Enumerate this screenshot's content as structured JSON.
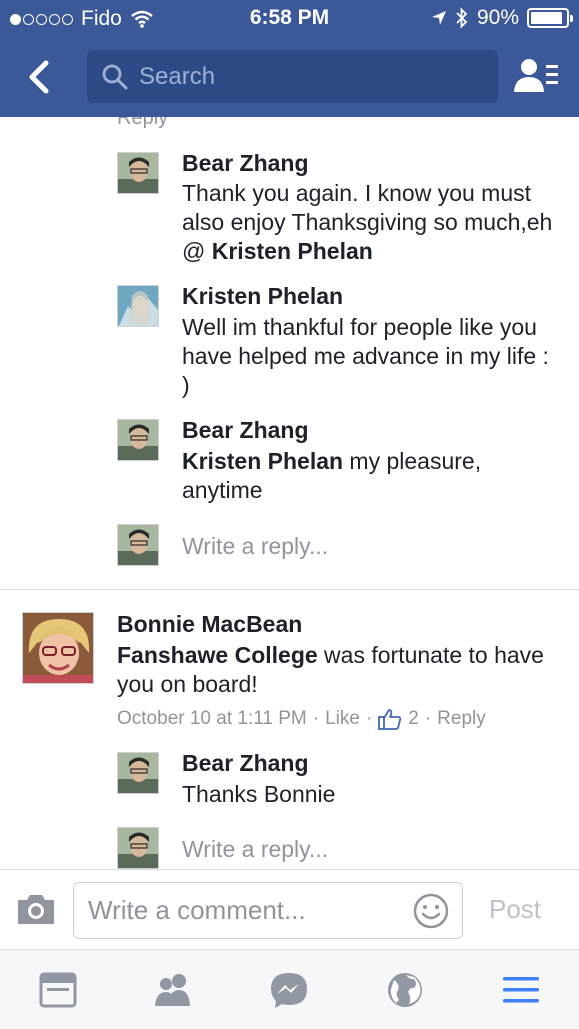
{
  "status": {
    "carrier": "Fido",
    "time": "6:58 PM",
    "battery": "90%"
  },
  "nav": {
    "search_placeholder": "Search"
  },
  "thread": {
    "partial_reply": "Reply",
    "replies": [
      {
        "name": "Bear Zhang",
        "text": "Thank you again. I know you must also enjoy Thanksgiving so much,eh @ ",
        "mention": "Kristen Phelan"
      },
      {
        "name": "Kristen Phelan",
        "text": "Well im thankful for people like you have helped me advance in my life : )"
      },
      {
        "name": "Bear Zhang",
        "mention": "Kristen Phelan",
        "text": " my pleasure, anytime"
      }
    ],
    "write_reply_placeholder": "Write a reply..."
  },
  "comment": {
    "name": "Bonnie MacBean",
    "mention": "Fanshawe College",
    "text": " was fortunate to have you on board!",
    "timestamp": "October 10 at 1:11 PM",
    "sep1": "·",
    "like_label": "Like",
    "sep2": "·",
    "like_count": "2",
    "sep3": "·",
    "reply_label": "Reply",
    "reply": {
      "name": "Bear Zhang",
      "text": "Thanks Bonnie"
    },
    "write_reply_placeholder": "Write a reply..."
  },
  "compose": {
    "placeholder": "Write a comment...",
    "post_label": "Post"
  },
  "tabs": [
    {
      "icon": "news-feed-icon"
    },
    {
      "icon": "friends-icon"
    },
    {
      "icon": "messenger-icon"
    },
    {
      "icon": "globe-icon"
    },
    {
      "icon": "menu-icon"
    }
  ],
  "colors": {
    "brand": "#3b5998",
    "search_bg": "#2e4a86",
    "secondary_text": "#90949c",
    "active_tab": "#4080ff"
  }
}
